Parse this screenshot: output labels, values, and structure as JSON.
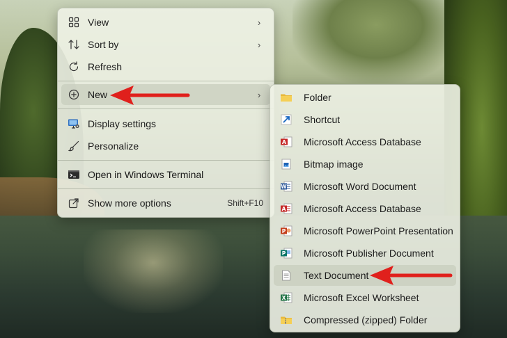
{
  "context_menu": {
    "items": [
      {
        "label": "View",
        "icon": "grid-icon",
        "has_submenu": true
      },
      {
        "label": "Sort by",
        "icon": "sort-icon",
        "has_submenu": true
      },
      {
        "label": "Refresh",
        "icon": "refresh-icon",
        "has_submenu": false
      },
      {
        "label": "New",
        "icon": "plus-circle-icon",
        "has_submenu": true
      },
      {
        "label": "Display settings",
        "icon": "display-settings-icon",
        "has_submenu": false
      },
      {
        "label": "Personalize",
        "icon": "brush-icon",
        "has_submenu": false
      },
      {
        "label": "Open in Windows Terminal",
        "icon": "terminal-icon",
        "has_submenu": false
      },
      {
        "label": "Show more options",
        "icon": "show-more-icon",
        "shortcut": "Shift+F10"
      }
    ]
  },
  "new_submenu": {
    "items": [
      {
        "label": "Folder",
        "icon": "folder-icon"
      },
      {
        "label": "Shortcut",
        "icon": "shortcut-icon"
      },
      {
        "label": "Microsoft Access Database",
        "icon": "access-icon"
      },
      {
        "label": "Bitmap image",
        "icon": "bitmap-icon"
      },
      {
        "label": "Microsoft Word Document",
        "icon": "word-icon"
      },
      {
        "label": "Microsoft Access Database",
        "icon": "access-doc-icon"
      },
      {
        "label": "Microsoft PowerPoint Presentation",
        "icon": "powerpoint-icon"
      },
      {
        "label": "Microsoft Publisher Document",
        "icon": "publisher-icon"
      },
      {
        "label": "Text Document",
        "icon": "text-document-icon"
      },
      {
        "label": "Microsoft Excel Worksheet",
        "icon": "excel-icon"
      },
      {
        "label": "Compressed (zipped) Folder",
        "icon": "zip-folder-icon"
      }
    ]
  },
  "colors": {
    "annotation_arrow": "#e0201c",
    "menu_background": "#eef2e6",
    "hover": "#c8cebe"
  }
}
